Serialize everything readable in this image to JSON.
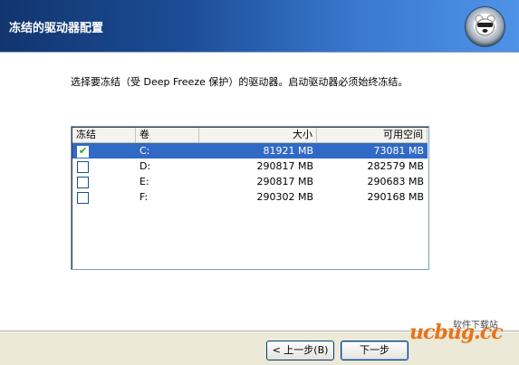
{
  "header": {
    "title": "冻结的驱动器配置",
    "logo_icon": "polar-bear-logo-icon"
  },
  "instruction": "选择要冻结（受 Deep Freeze 保护）的驱动器。启动驱动器必须始终冻结。",
  "table": {
    "columns": [
      "冻结",
      "卷",
      "大小",
      "可用空间"
    ],
    "rows": [
      {
        "frozen": true,
        "volume": "C:",
        "size": "81921 MB",
        "free": "73081 MB"
      },
      {
        "frozen": false,
        "volume": "D:",
        "size": "290817 MB",
        "free": "282579 MB"
      },
      {
        "frozen": false,
        "volume": "E:",
        "size": "290817 MB",
        "free": "290683 MB"
      },
      {
        "frozen": false,
        "volume": "F:",
        "size": "290302 MB",
        "free": "290168 MB"
      }
    ]
  },
  "buttons": {
    "back": "< 上一步(B)",
    "next": "下一步"
  },
  "watermark": {
    "top_text": "软件下载站",
    "brand": "ucbug.cc"
  },
  "colors": {
    "header_dark": "#12356f",
    "header_light": "#4f93e6",
    "selection": "#3169c6",
    "check": "#21a121",
    "watermark": "#e8731a"
  }
}
